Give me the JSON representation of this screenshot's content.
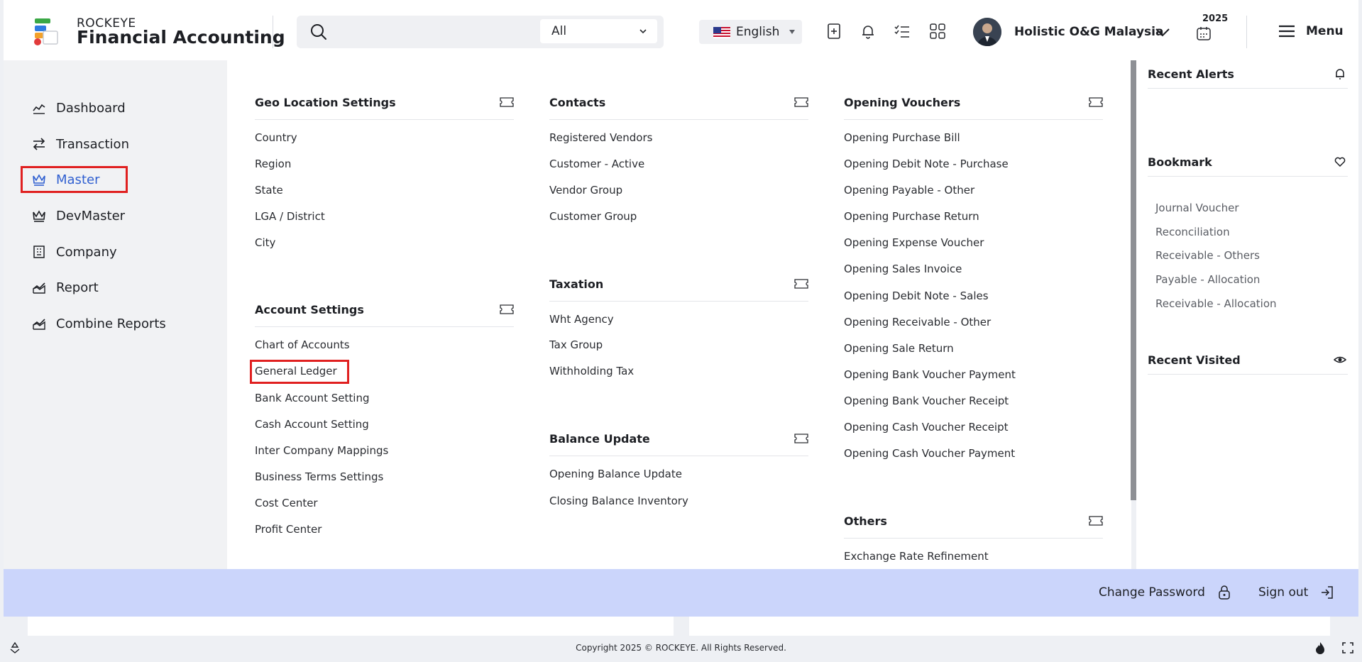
{
  "header": {
    "brand_small": "ROCKEYE",
    "brand_title": "Financial Accounting",
    "search_scope": "All",
    "language": "English",
    "company": "Holistic O&G Malaysia",
    "year": "2025",
    "menu_label": "Menu"
  },
  "sidebar": {
    "items": [
      {
        "label": "Dashboard",
        "icon": "chart-line-icon"
      },
      {
        "label": "Transaction",
        "icon": "arrows-exchange-icon"
      },
      {
        "label": "Master",
        "icon": "crown-icon",
        "active": true
      },
      {
        "label": "DevMaster",
        "icon": "crown-icon"
      },
      {
        "label": "Company",
        "icon": "building-icon"
      },
      {
        "label": "Report",
        "icon": "report-chart-icon"
      },
      {
        "label": "Combine Reports",
        "icon": "report-chart-icon"
      }
    ]
  },
  "menu": {
    "geo": {
      "title": "Geo Location Settings",
      "links": [
        "Country",
        "Region",
        "State",
        "LGA / District",
        "City"
      ]
    },
    "account": {
      "title": "Account Settings",
      "links": [
        "Chart of Accounts",
        "General Ledger",
        "Bank Account Setting",
        "Cash Account Setting",
        "Inter Company Mappings",
        "Business Terms Settings",
        "Cost Center",
        "Profit Center"
      ]
    },
    "contacts": {
      "title": "Contacts",
      "links": [
        "Registered Vendors",
        "Customer - Active",
        "Vendor Group",
        "Customer Group"
      ]
    },
    "taxation": {
      "title": "Taxation",
      "links": [
        "Wht Agency",
        "Tax Group",
        "Withholding Tax"
      ]
    },
    "balance": {
      "title": "Balance Update",
      "links": [
        "Opening Balance Update",
        "Closing Balance Inventory"
      ]
    },
    "opening": {
      "title": "Opening Vouchers",
      "links": [
        "Opening Purchase Bill",
        "Opening Debit Note - Purchase",
        "Opening Payable - Other",
        "Opening Purchase Return",
        "Opening Expense Voucher",
        "Opening Sales Invoice",
        "Opening Debit Note - Sales",
        "Opening Receivable - Other",
        "Opening Sale Return",
        "Opening Bank Voucher Payment",
        "Opening Bank Voucher Receipt",
        "Opening Cash Voucher Receipt",
        "Opening Cash Voucher Payment"
      ]
    },
    "others": {
      "title": "Others",
      "links": [
        "Exchange Rate Refinement"
      ]
    }
  },
  "right_panel": {
    "alerts_title": "Recent Alerts",
    "bookmark_title": "Bookmark",
    "bookmarks": [
      "Journal Voucher",
      "Reconciliation",
      "Receivable - Others",
      "Payable - Allocation",
      "Receivable - Allocation"
    ],
    "visited_title": "Recent Visited"
  },
  "footer": {
    "change_password": "Change Password",
    "sign_out": "Sign out",
    "copyright": "Copyright 2025 © ROCKEYE. All Rights Reserved."
  },
  "colors": {
    "accent": "#2f5fd0",
    "highlight": "#e02020",
    "footer_bar": "#cbd5fb"
  }
}
